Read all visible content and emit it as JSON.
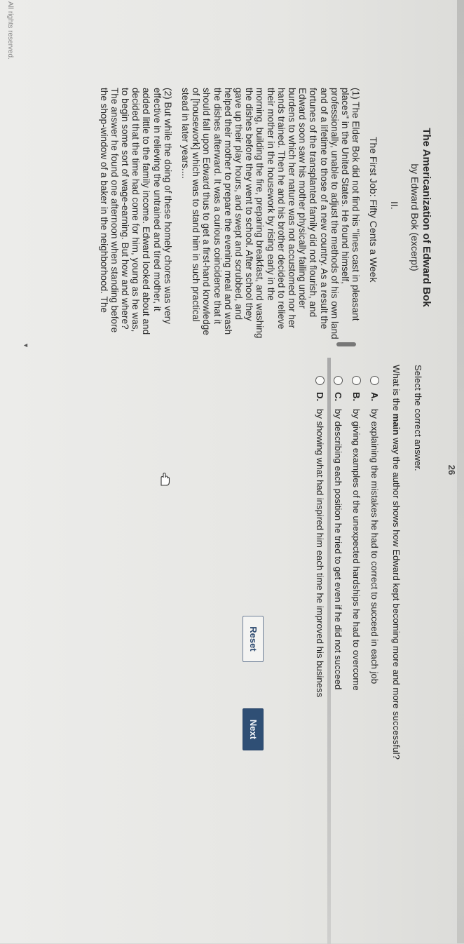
{
  "header": {
    "page_number": "26"
  },
  "passage": {
    "title": "The Americanization of Edward Bok",
    "byline": "by Edward Bok (excerpt)",
    "chapter": "II.",
    "subheading": "The First Job: Fifty Cents a Week",
    "paragraphs": [
      "(1) The Elder Bok did not find his \"lines cast in pleasant places\" in the United States. He found himself, professionally, unable to adjust the methods of his own land and of a lifetime to those of a new country. As a result the fortunes of the transplanted family did not flourish, and Edward soon saw his mother physically failing under burdens to which her nature was not accustomed nor her hands trained. Then he and his brother decided to relieve their mother in the housework by rising early in the morning, building the fire, preparing breakfast, and washing the dishes before they went to school. After school they gave up their play hours, and swept and scrubbed, and helped their mother to prepare the evening meal and wash the dishes afterward. It was a curious coincidence that it should fall upon Edward thus to get a first-hand knowledge of [housework] which was to stand him in such practical stead in later years....",
      "(2) But while the doing of these homely chores was very effective in relieving the untrained and tired mother, it added little to the family income. Edward looked about and decided that the time had come for him, young as he was, to begin some sort of wage-earning. But how and where? The answer he found one afternoon when standing before the shop-window of a baker in the neighborhood. The"
    ],
    "footer": "All rights reserved."
  },
  "question": {
    "instructions": "Select the correct answer.",
    "prompt_before": "What is the ",
    "prompt_bold": "main",
    "prompt_after": " way the author shows how Edward kept becoming more and more successful?",
    "options": [
      {
        "letter": "A.",
        "text": "by explaining the mistakes he had to correct to succeed in each job"
      },
      {
        "letter": "B.",
        "text": "by giving examples of the unexpected hardships he had to overcome"
      },
      {
        "letter": "C.",
        "text": "by describing each position he tried to get even if he did not succeed"
      },
      {
        "letter": "D.",
        "text": "by showing what had inspired him each time he improved his business"
      }
    ]
  },
  "buttons": {
    "reset_label": "Reset",
    "next_label": "Next"
  },
  "colors": {
    "next_bg": "#2f4f75",
    "reset_border": "#6e7f97"
  }
}
